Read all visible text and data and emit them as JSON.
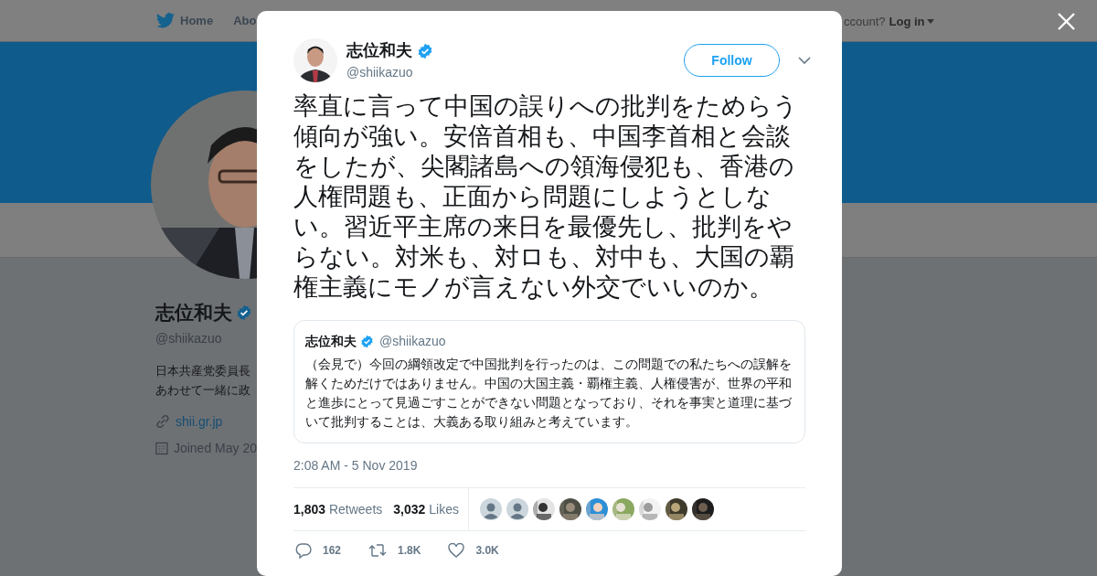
{
  "top_nav": {
    "items": [
      "Home",
      "Abo"
    ],
    "account_prompt": "ccount?",
    "login": "Log in"
  },
  "profile": {
    "name": "志位和夫",
    "handle": "@shiikazuo",
    "bio_lines": [
      "日本共産党委員長",
      "あわせて一緒に政"
    ],
    "website": "shii.gr.jp",
    "joined": "Joined May 20"
  },
  "tweet": {
    "author": {
      "name": "志位和夫",
      "handle": "@shiikazuo",
      "verified": true
    },
    "follow_button": "Follow",
    "text": "率直に言って中国の誤りへの批判をためらう傾向が強い。安倍首相も、中国李首相と会談をしたが、尖閣諸島への領海侵犯も、香港の人権問題も、正面から問題にしようとしない。習近平主席の来日を最優先し、批判をやらない。対米も、対ロも、対中も、大国の覇権主義にモノが言えない外交でいいのか。",
    "quoted": {
      "name": "志位和夫",
      "verified": true,
      "handle": "@shiikazuo",
      "text": "（会見で）今回の綱領改定で中国批判を行ったのは、この問題での私たちへの誤解を解くためだけではありません。中国の大国主義・覇権主義、人権侵害が、世界の平和と進歩にとって見過ごすことができない問題となっており、それを事実と道理に基づいて批判することは、大義ある取り組みと考えています。"
    },
    "timestamp": "2:08 AM - 5 Nov 2019",
    "stats": [
      {
        "count": "1,803",
        "label": "Retweets"
      },
      {
        "count": "3,032",
        "label": "Likes"
      }
    ],
    "likers": [
      {
        "kind": "default"
      },
      {
        "kind": "default"
      },
      {
        "kind": "picture"
      },
      {
        "kind": "picture"
      },
      {
        "kind": "picture"
      },
      {
        "kind": "picture"
      },
      {
        "kind": "picture"
      },
      {
        "kind": "picture"
      },
      {
        "kind": "picture"
      }
    ],
    "actions": [
      {
        "kind": "reply",
        "count": "162"
      },
      {
        "kind": "retweet",
        "count": "1.8K"
      },
      {
        "kind": "like",
        "count": "3.0K"
      }
    ]
  }
}
